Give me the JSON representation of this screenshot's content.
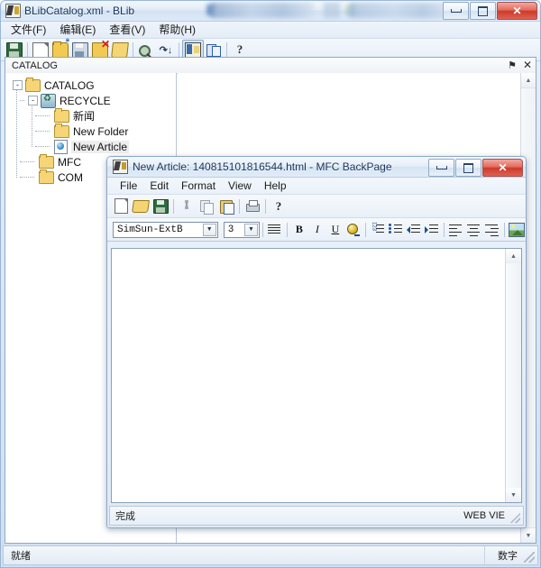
{
  "main_window": {
    "title": "BLibCatalog.xml - BLib",
    "icon": "app-icon",
    "window_controls": {
      "minimize": "minimize",
      "maximize": "maximize",
      "close": "✕"
    },
    "menu": [
      {
        "label": "文件(F)",
        "name": "file"
      },
      {
        "label": "编辑(E)",
        "name": "edit"
      },
      {
        "label": "查看(V)",
        "name": "view"
      },
      {
        "label": "帮助(H)",
        "name": "help"
      }
    ],
    "toolbar": [
      {
        "name": "save-icon",
        "tip": "Save"
      },
      {
        "name": "new-document-icon",
        "tip": "New Document"
      },
      {
        "name": "new-folder-icon",
        "tip": "New Folder"
      },
      {
        "name": "save-as-icon",
        "tip": "Save As"
      },
      {
        "name": "delete-folder-icon",
        "tip": "Delete Folder"
      },
      {
        "name": "open-folder-icon",
        "tip": "Open Folder"
      },
      {
        "name": "search-icon",
        "tip": "Search"
      },
      {
        "name": "find-next-icon",
        "tip": "Find Next"
      },
      {
        "name": "window-view-icon",
        "tip": "Window View"
      },
      {
        "name": "arrange-panes-icon",
        "tip": "Arrange Panes"
      },
      {
        "name": "help-icon",
        "tip": "Help"
      }
    ],
    "pane": {
      "title": "CATALOG",
      "pin_icon": "⚑",
      "close_icon": "✕"
    },
    "tree": [
      {
        "label": "CATALOG",
        "icon": "folder",
        "depth": 0,
        "expander": "-",
        "selected": false
      },
      {
        "label": "RECYCLE",
        "icon": "recycle",
        "depth": 1,
        "expander": "-",
        "selected": false
      },
      {
        "label": "新闻",
        "icon": "folder",
        "depth": 2,
        "expander": "",
        "selected": false
      },
      {
        "label": "New Folder",
        "icon": "folder",
        "depth": 2,
        "expander": "",
        "selected": false
      },
      {
        "label": "New Article",
        "icon": "article",
        "depth": 2,
        "expander": "",
        "selected": true
      },
      {
        "label": "MFC",
        "icon": "folder",
        "depth": 1,
        "expander": "",
        "selected": false
      },
      {
        "label": "COM",
        "icon": "folder",
        "depth": 1,
        "expander": "",
        "selected": false
      }
    ],
    "status": {
      "left": "就绪",
      "right": "数字"
    }
  },
  "child_window": {
    "title": "New Article: 140815101816544.html - MFC BackPage",
    "icon": "app-icon",
    "window_controls": {
      "minimize": "minimize",
      "maximize": "maximize",
      "close": "✕"
    },
    "menu": [
      {
        "label": "File",
        "name": "file"
      },
      {
        "label": "Edit",
        "name": "edit"
      },
      {
        "label": "Format",
        "name": "format"
      },
      {
        "label": "View",
        "name": "view"
      },
      {
        "label": "Help",
        "name": "help"
      }
    ],
    "toolbar": [
      {
        "name": "new-icon",
        "tip": "New"
      },
      {
        "name": "open-icon",
        "tip": "Open"
      },
      {
        "name": "save-icon",
        "tip": "Save"
      },
      {
        "name": "cut-icon",
        "tip": "Cut"
      },
      {
        "name": "copy-icon",
        "tip": "Copy"
      },
      {
        "name": "paste-icon",
        "tip": "Paste"
      },
      {
        "name": "print-icon",
        "tip": "Print"
      },
      {
        "name": "help-icon",
        "tip": "About"
      }
    ],
    "format_bar": {
      "font_name": "SimSun-ExtB",
      "font_size": "3",
      "dropdown_arrow": "▼",
      "buttons": [
        {
          "name": "paragraph-style-icon",
          "tip": "Paragraph Style"
        },
        {
          "name": "bold-icon",
          "label": "B"
        },
        {
          "name": "italic-icon",
          "label": "I"
        },
        {
          "name": "underline-icon",
          "label": "U"
        },
        {
          "name": "text-color-icon",
          "tip": "Text Color"
        },
        {
          "name": "numbered-list-icon",
          "tip": "Numbered List"
        },
        {
          "name": "bullet-list-icon",
          "tip": "Bullet List"
        },
        {
          "name": "decrease-indent-icon",
          "tip": "Decrease Indent"
        },
        {
          "name": "increase-indent-icon",
          "tip": "Increase Indent"
        },
        {
          "name": "align-left-icon",
          "tip": "Align Left"
        },
        {
          "name": "align-center-icon",
          "tip": "Align Center"
        },
        {
          "name": "align-right-icon",
          "tip": "Align Right"
        },
        {
          "name": "insert-image-icon",
          "tip": "Insert Image"
        }
      ]
    },
    "editor": {
      "content": ""
    },
    "scroll": {
      "up_arrow": "▲",
      "down_arrow": "▼"
    },
    "status": {
      "left": "完成",
      "right": "WEB VIE"
    }
  },
  "colors": {
    "titlebar_text": "#16335c",
    "close_button": "#cd3a29",
    "folder_icon": "#f6d577",
    "selection": "#ededed",
    "window_border": "#8ba8c8"
  }
}
